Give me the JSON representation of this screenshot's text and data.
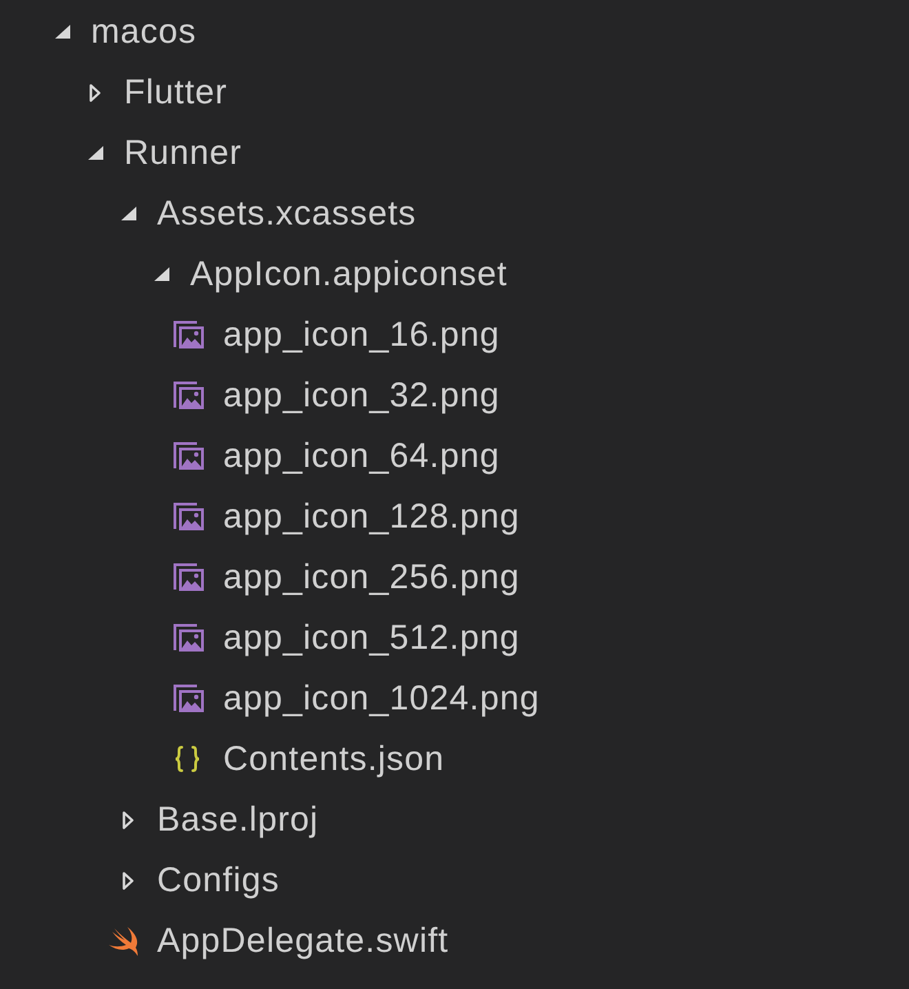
{
  "tree": [
    {
      "name": "macos",
      "kind": "folder",
      "expanded": true,
      "children": [
        {
          "name": "Flutter",
          "kind": "folder",
          "expanded": false
        },
        {
          "name": "Runner",
          "kind": "folder",
          "expanded": true,
          "children": [
            {
              "name": "Assets.xcassets",
              "kind": "folder",
              "expanded": true,
              "children": [
                {
                  "name": "AppIcon.appiconset",
                  "kind": "folder",
                  "expanded": true,
                  "children": [
                    {
                      "name": "app_icon_16.png",
                      "kind": "image"
                    },
                    {
                      "name": "app_icon_32.png",
                      "kind": "image"
                    },
                    {
                      "name": "app_icon_64.png",
                      "kind": "image"
                    },
                    {
                      "name": "app_icon_128.png",
                      "kind": "image"
                    },
                    {
                      "name": "app_icon_256.png",
                      "kind": "image"
                    },
                    {
                      "name": "app_icon_512.png",
                      "kind": "image"
                    },
                    {
                      "name": "app_icon_1024.png",
                      "kind": "image"
                    },
                    {
                      "name": "Contents.json",
                      "kind": "json"
                    }
                  ]
                }
              ]
            },
            {
              "name": "Base.lproj",
              "kind": "folder",
              "expanded": false
            },
            {
              "name": "Configs",
              "kind": "folder",
              "expanded": false
            },
            {
              "name": "AppDelegate.swift",
              "kind": "swift"
            }
          ]
        }
      ]
    }
  ]
}
